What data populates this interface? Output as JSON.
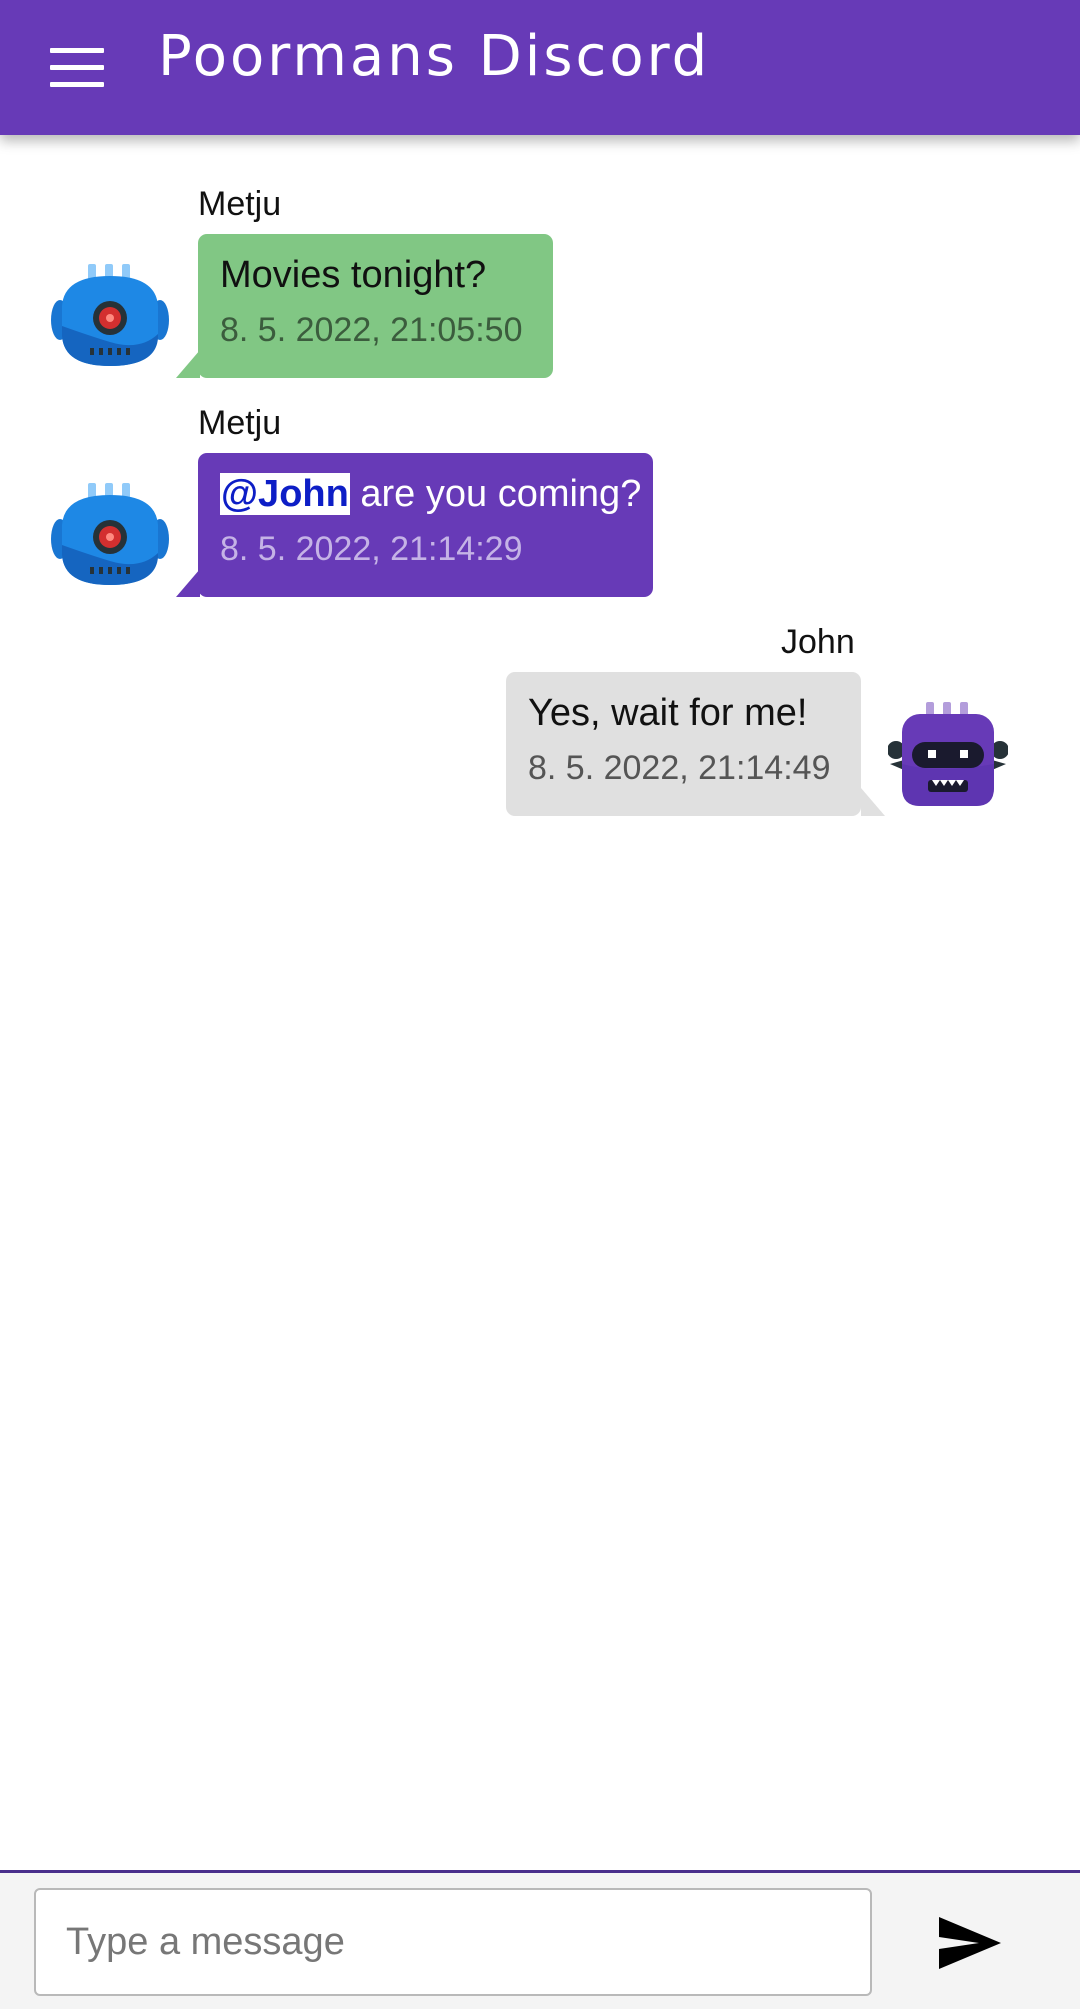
{
  "header": {
    "title": "Poormans Discord",
    "menu_icon": "hamburger-menu-icon",
    "color": "#673ab7"
  },
  "messages": [
    {
      "sender": "Metju",
      "text": "Movies tonight?",
      "timestamp": "8. 5. 2022, 21:05:50",
      "side": "left",
      "bubble_color": "#81c784",
      "avatar": "blue-robot-avatar"
    },
    {
      "sender": "Metju",
      "mention": "@John",
      "text": " are you coming?",
      "timestamp": "8. 5. 2022, 21:14:29",
      "side": "left",
      "bubble_color": "#673ab7",
      "avatar": "blue-robot-avatar"
    },
    {
      "sender": "John",
      "text": "Yes, wait for me!",
      "timestamp": "8. 5. 2022, 21:14:49",
      "side": "right",
      "bubble_color": "#e0e0e0",
      "avatar": "purple-robot-avatar"
    }
  ],
  "composer": {
    "placeholder": "Type a message",
    "value": "",
    "send_icon": "send-icon"
  }
}
